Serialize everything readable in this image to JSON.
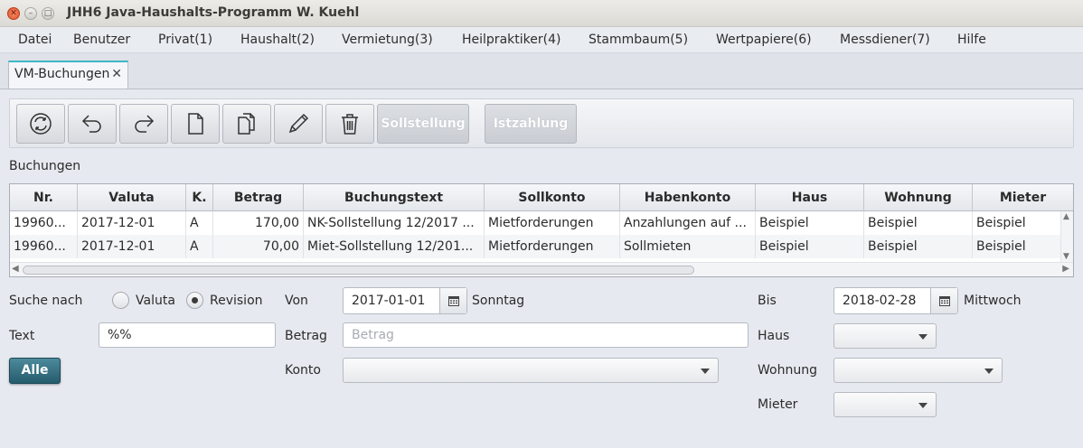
{
  "window": {
    "title": "JHH6 Java-Haushalts-Programm W. Kuehl"
  },
  "menu": [
    "Datei",
    "Benutzer",
    "Privat(1)",
    "Haushalt(2)",
    "Vermietung(3)",
    "Heilpraktiker(4)",
    "Stammbaum(5)",
    "Wertpapiere(6)",
    "Messdiener(7)",
    "Hilfe"
  ],
  "tab": {
    "label": "VM-Buchungen",
    "close": "✕"
  },
  "toolbar": {
    "icons": [
      "refresh-icon",
      "undo-icon",
      "redo-icon",
      "new-document-icon",
      "copy-icon",
      "edit-pencil-icon",
      "delete-trash-icon"
    ],
    "sollstellung": "Sollstellung",
    "istzahlung": "Istzahlung",
    "text_button_color": "#fdfdfd"
  },
  "section_label": "Buchungen",
  "table": {
    "columns": [
      "Nr.",
      "Valuta",
      "K.",
      "Betrag",
      "Buchungstext",
      "Sollkonto",
      "Habenkonto",
      "Haus",
      "Wohnung",
      "Mieter"
    ],
    "rows": [
      [
        "19960...",
        "2017-12-01",
        "A",
        "170,00",
        "NK-Sollstellung 12/2017 ...",
        "Mietforderungen",
        "Anzahlungen auf ...",
        "Beispiel",
        "Beispiel",
        "Beispiel"
      ],
      [
        "19960...",
        "2017-12-01",
        "A",
        "70,00",
        "Miet-Sollstellung 12/201...",
        "Mietforderungen",
        "Sollmieten",
        "Beispiel",
        "Beispiel",
        "Beispiel"
      ]
    ]
  },
  "form": {
    "suche_nach": "Suche nach",
    "radio_valuta": "Valuta",
    "radio_revision": "Revision",
    "selected": "Revision",
    "von_label": "Von",
    "von_value": "2017-01-01",
    "von_weekday": "Sonntag",
    "bis_label": "Bis",
    "bis_value": "2018-02-28",
    "bis_weekday": "Mittwoch",
    "text_label": "Text",
    "text_value": "%%",
    "betrag_label": "Betrag",
    "betrag_placeholder": "Betrag",
    "konto_label": "Konto",
    "haus_label": "Haus",
    "wohnung_label": "Wohnung",
    "mieter_label": "Mieter",
    "alle_button": "Alle"
  },
  "colors": {
    "accent_tab": "#3fb6c6",
    "alle_button": "#245c6d",
    "close_button": "#e2522c"
  }
}
